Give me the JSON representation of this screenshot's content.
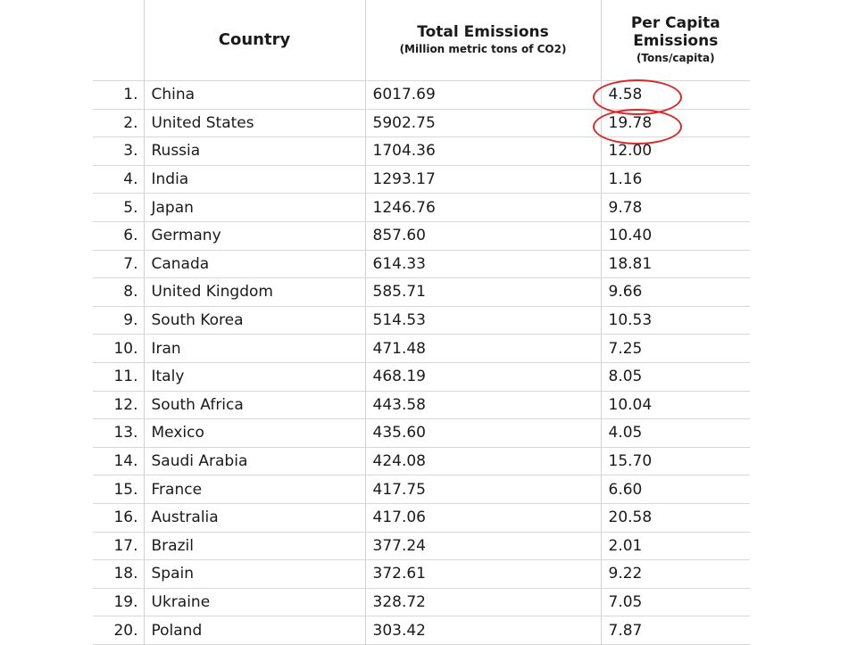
{
  "table": {
    "headers": {
      "country": "Country",
      "total_main": "Total Emissions",
      "total_sub": "(Million metric tons of CO2)",
      "percap_main_1": "Per Capita",
      "percap_main_2": "Emissions",
      "percap_sub": "(Tons/capita)"
    },
    "rows": [
      {
        "rank": "1.",
        "country": "China",
        "total": "6017.69",
        "per_capita": "4.58"
      },
      {
        "rank": "2.",
        "country": "United States",
        "total": "5902.75",
        "per_capita": "19.78"
      },
      {
        "rank": "3.",
        "country": "Russia",
        "total": "1704.36",
        "per_capita": "12.00"
      },
      {
        "rank": "4.",
        "country": "India",
        "total": "1293.17",
        "per_capita": "1.16"
      },
      {
        "rank": "5.",
        "country": "Japan",
        "total": "1246.76",
        "per_capita": "9.78"
      },
      {
        "rank": "6.",
        "country": "Germany",
        "total": "857.60",
        "per_capita": "10.40"
      },
      {
        "rank": "7.",
        "country": "Canada",
        "total": "614.33",
        "per_capita": "18.81"
      },
      {
        "rank": "8.",
        "country": "United Kingdom",
        "total": "585.71",
        "per_capita": "9.66"
      },
      {
        "rank": "9.",
        "country": "South Korea",
        "total": "514.53",
        "per_capita": "10.53"
      },
      {
        "rank": "10.",
        "country": "Iran",
        "total": "471.48",
        "per_capita": "7.25"
      },
      {
        "rank": "11.",
        "country": "Italy",
        "total": "468.19",
        "per_capita": "8.05"
      },
      {
        "rank": "12.",
        "country": "South Africa",
        "total": "443.58",
        "per_capita": "10.04"
      },
      {
        "rank": "13.",
        "country": "Mexico",
        "total": "435.60",
        "per_capita": "4.05"
      },
      {
        "rank": "14.",
        "country": "Saudi Arabia",
        "total": "424.08",
        "per_capita": "15.70"
      },
      {
        "rank": "15.",
        "country": "France",
        "total": "417.75",
        "per_capita": "6.60"
      },
      {
        "rank": "16.",
        "country": "Australia",
        "total": "417.06",
        "per_capita": "20.58"
      },
      {
        "rank": "17.",
        "country": "Brazil",
        "total": "377.24",
        "per_capita": "2.01"
      },
      {
        "rank": "18.",
        "country": "Spain",
        "total": "372.61",
        "per_capita": "9.22"
      },
      {
        "rank": "19.",
        "country": "Ukraine",
        "total": "328.72",
        "per_capita": "7.05"
      },
      {
        "rank": "20.",
        "country": "Poland",
        "total": "303.42",
        "per_capita": "7.87"
      }
    ]
  },
  "annotations": {
    "highlight_color": "#d62a2a",
    "highlighted_rows": [
      1,
      2
    ]
  }
}
